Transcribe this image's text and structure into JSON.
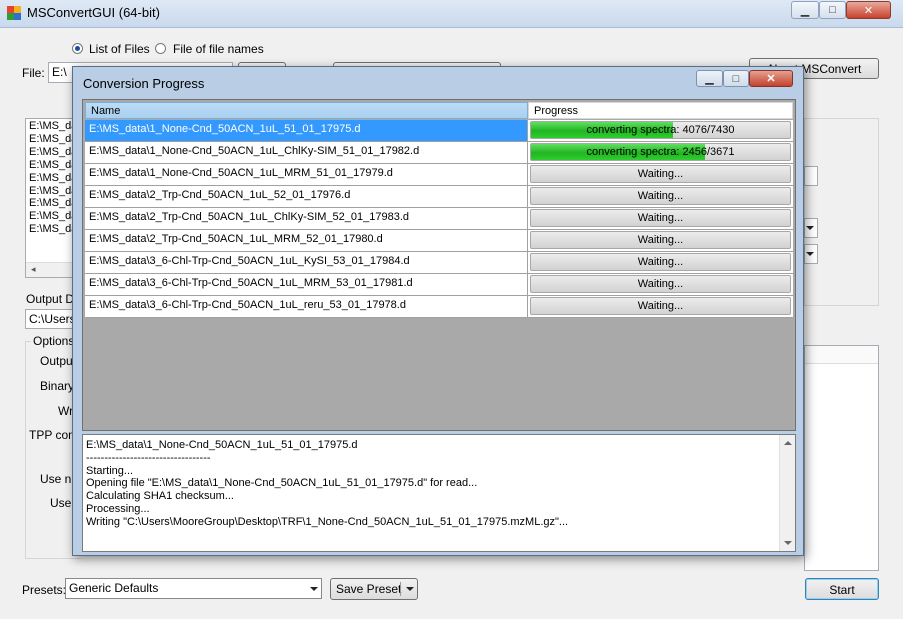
{
  "window": {
    "title": "MSConvertGUI (64-bit)",
    "controls": {
      "minimize": "▁",
      "maximize": "□",
      "close": "✕"
    }
  },
  "input_mode": {
    "list_of_files": "List of Files",
    "file_of_file_names": "File of file names",
    "selected": "list_of_files"
  },
  "file_label": "File:",
  "file_value": "E:\\",
  "about_button": "About MSConvert",
  "file_list_items": [
    "E:\\MS_da",
    "E:\\MS_da",
    "E:\\MS_da",
    "E:\\MS_da",
    "E:\\MS_da",
    "E:\\MS_da",
    "E:\\MS_da",
    "E:\\MS_da",
    "E:\\MS_da"
  ],
  "output_dir_label": "Output Di",
  "output_dir_value": "C:\\Users",
  "options": {
    "group_label": "Options",
    "output_label": "Output",
    "binary_label": "Binary e",
    "write_label": "Writ",
    "tpp_label": "TPP com",
    "use_num1": "Use nu",
    "use_num2": "Use n"
  },
  "presets": {
    "label": "Presets:",
    "value": "Generic Defaults",
    "save_button": "Save Preset"
  },
  "start_button": "Start",
  "dialog": {
    "title": "Conversion Progress",
    "columns": {
      "name": "Name",
      "progress": "Progress"
    },
    "rows": [
      {
        "name": "E:\\MS_data\\1_None-Cnd_50ACN_1uL_51_01_17975.d",
        "status": "converting spectra: 4076/7430",
        "progress": 0.55,
        "selected": true
      },
      {
        "name": "E:\\MS_data\\1_None-Cnd_50ACN_1uL_ChlKy-SIM_51_01_17982.d",
        "status": "converting spectra: 2456/3671",
        "progress": 0.67,
        "selected": false
      },
      {
        "name": "E:\\MS_data\\1_None-Cnd_50ACN_1uL_MRM_51_01_17979.d",
        "status": "Waiting...",
        "progress": 0,
        "selected": false
      },
      {
        "name": "E:\\MS_data\\2_Trp-Cnd_50ACN_1uL_52_01_17976.d",
        "status": "Waiting...",
        "progress": 0,
        "selected": false
      },
      {
        "name": "E:\\MS_data\\2_Trp-Cnd_50ACN_1uL_ChlKy-SIM_52_01_17983.d",
        "status": "Waiting...",
        "progress": 0,
        "selected": false
      },
      {
        "name": "E:\\MS_data\\2_Trp-Cnd_50ACN_1uL_MRM_52_01_17980.d",
        "status": "Waiting...",
        "progress": 0,
        "selected": false
      },
      {
        "name": "E:\\MS_data\\3_6-Chl-Trp-Cnd_50ACN_1uL_KySI_53_01_17984.d",
        "status": "Waiting...",
        "progress": 0,
        "selected": false
      },
      {
        "name": "E:\\MS_data\\3_6-Chl-Trp-Cnd_50ACN_1uL_MRM_53_01_17981.d",
        "status": "Waiting...",
        "progress": 0,
        "selected": false
      },
      {
        "name": "E:\\MS_data\\3_6-Chl-Trp-Cnd_50ACN_1uL_reru_53_01_17978.d",
        "status": "Waiting...",
        "progress": 0,
        "selected": false
      }
    ],
    "log_lines": [
      "E:\\MS_data\\1_None-Cnd_50ACN_1uL_51_01_17975.d",
      "----------------------------------",
      "Starting...",
      "Opening file \"E:\\MS_data\\1_None-Cnd_50ACN_1uL_51_01_17975.d\" for read...",
      "Calculating SHA1 checksum...",
      "Processing...",
      "Writing \"C:\\Users\\MooreGroup\\Desktop\\TRF\\1_None-Cnd_50ACN_1uL_51_01_17975.mzML.gz\"..."
    ]
  }
}
